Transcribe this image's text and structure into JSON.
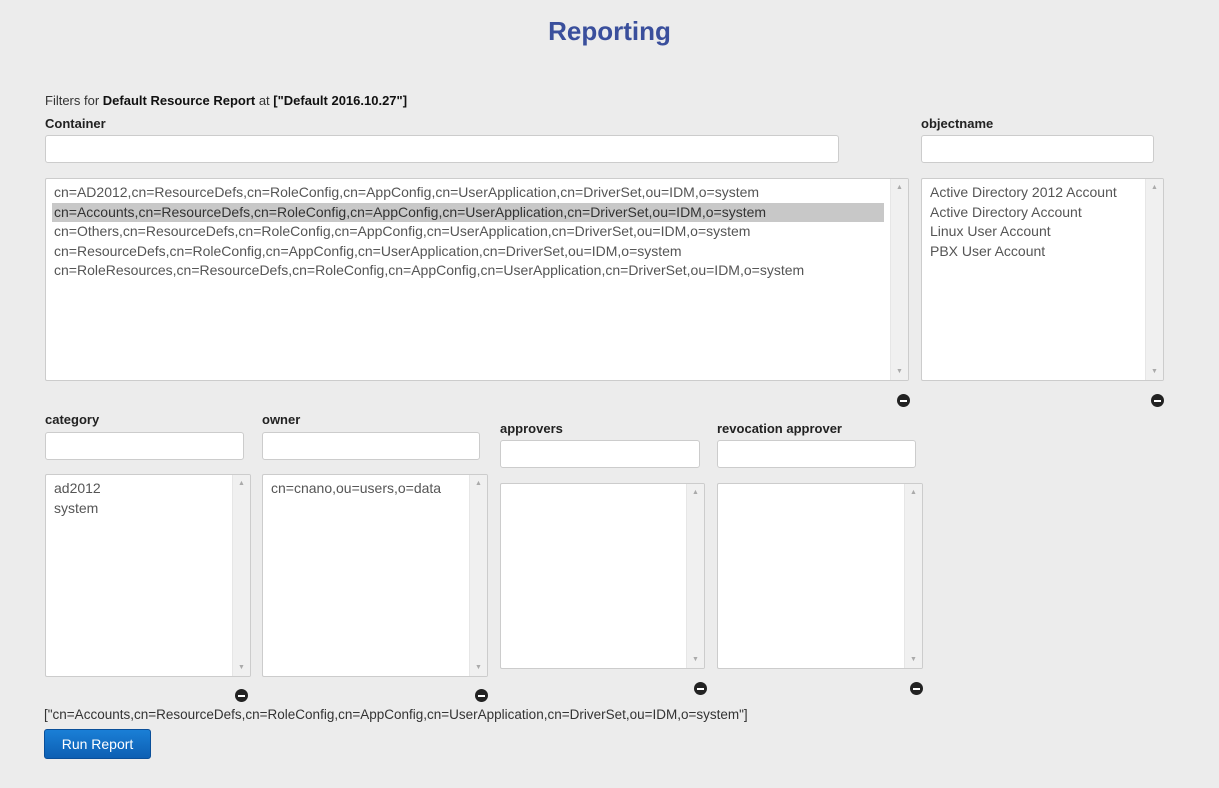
{
  "page": {
    "title": "Reporting"
  },
  "filters": {
    "prefix": "Filters for ",
    "report_name": "Default Resource Report",
    "middle": " at ",
    "config_name": "[\"Default 2016.10.27\"]"
  },
  "container": {
    "label": "Container",
    "input_value": "",
    "options": [
      "cn=AD2012,cn=ResourceDefs,cn=RoleConfig,cn=AppConfig,cn=UserApplication,cn=DriverSet,ou=IDM,o=system",
      "cn=Accounts,cn=ResourceDefs,cn=RoleConfig,cn=AppConfig,cn=UserApplication,cn=DriverSet,ou=IDM,o=system",
      "cn=Others,cn=ResourceDefs,cn=RoleConfig,cn=AppConfig,cn=UserApplication,cn=DriverSet,ou=IDM,o=system",
      "cn=ResourceDefs,cn=RoleConfig,cn=AppConfig,cn=UserApplication,cn=DriverSet,ou=IDM,o=system",
      "cn=RoleResources,cn=ResourceDefs,cn=RoleConfig,cn=AppConfig,cn=UserApplication,cn=DriverSet,ou=IDM,o=system"
    ],
    "selected_index": 1
  },
  "objectname": {
    "label": "objectname",
    "input_value": "",
    "options": [
      "Active Directory 2012 Account",
      "Active Directory Account",
      "Linux User Account",
      "PBX User Account"
    ]
  },
  "category": {
    "label": "category",
    "input_value": "",
    "options": [
      "ad2012",
      "system"
    ]
  },
  "owner": {
    "label": "owner",
    "input_value": "",
    "options": [
      "cn=cnano,ou=users,o=data"
    ]
  },
  "approvers": {
    "label": "approvers",
    "input_value": "",
    "options": []
  },
  "revocation_approver": {
    "label": "revocation approver",
    "input_value": "",
    "options": []
  },
  "selection_value": "[\"cn=Accounts,cn=ResourceDefs,cn=RoleConfig,cn=AppConfig,cn=UserApplication,cn=DriverSet,ou=IDM,o=system\"]",
  "run_report_label": "Run Report",
  "icons": {
    "remove": "minus-circle-icon",
    "scroll_up": "arrow-up-icon",
    "scroll_down": "arrow-down-icon"
  }
}
